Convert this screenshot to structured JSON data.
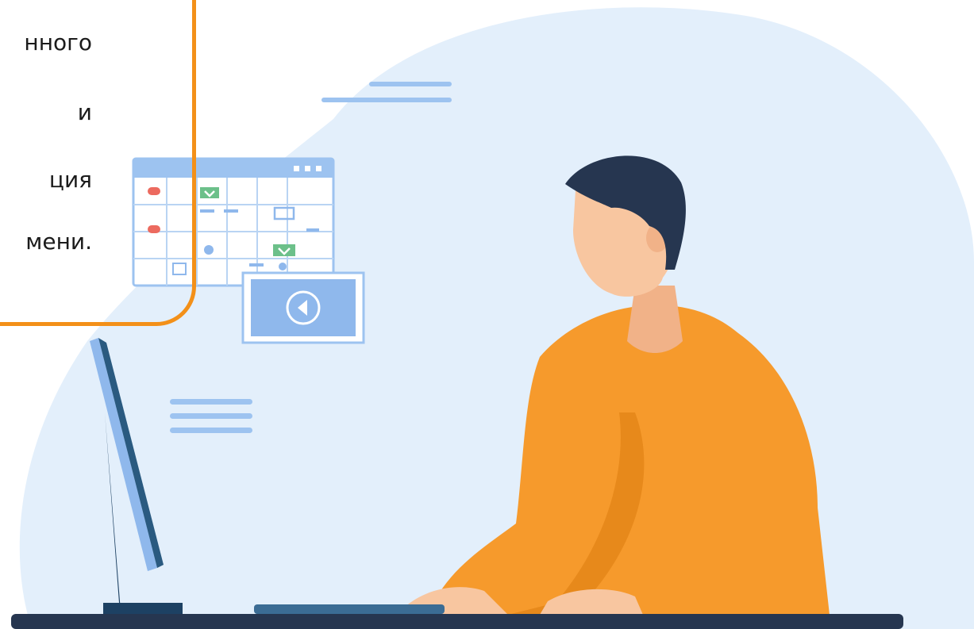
{
  "callout": {
    "lines": [
      "нного",
      "и",
      "ция",
      "мени."
    ],
    "border_color": "#f39019"
  },
  "colors": {
    "blob": "#e3effb",
    "shirt": "#f69a2c",
    "skin": "#f8c6a0",
    "hair": "#263650",
    "desk": "#263650",
    "monitor_blue": "#8fb8ec",
    "monitor_dark": "#2a5a80",
    "accent_line": "#9dc3f0"
  },
  "icons": {
    "calendar": "calendar-window-icon",
    "video": "video-play-icon",
    "checks": "checkmark-icon"
  }
}
